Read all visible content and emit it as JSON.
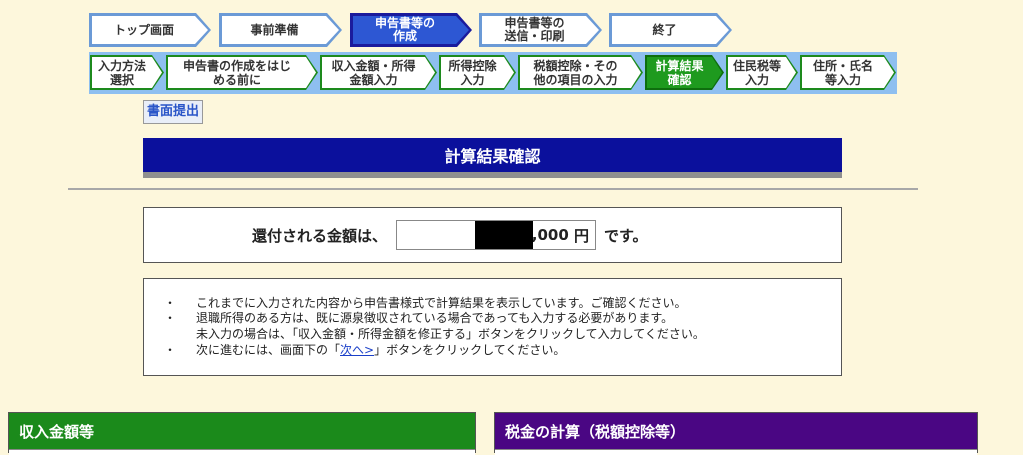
{
  "steps": [
    {
      "label": "トップ画面",
      "active": false
    },
    {
      "label": "事前準備",
      "active": false
    },
    {
      "label": "申告書等の\n作成",
      "active": true
    },
    {
      "label": "申告書等の\n送信・印刷",
      "active": false
    },
    {
      "label": "終了",
      "active": false
    }
  ],
  "substeps": [
    {
      "label": "入力方法\n選択",
      "active": false
    },
    {
      "label": "申告書の作成をはじ\nめる前に",
      "active": false
    },
    {
      "label": "収入金額・所得\n金額入力",
      "active": false
    },
    {
      "label": "所得控除\n入力",
      "active": false
    },
    {
      "label": "税額控除・その\n他の項目の入力",
      "active": false
    },
    {
      "label": "計算結果\n確認",
      "active": true
    },
    {
      "label": "住民税等\n入力",
      "active": false
    },
    {
      "label": "住所・氏名\n等入力",
      "active": false
    }
  ],
  "submit_label": "書面提出",
  "page_title": "計算結果確認",
  "refund": {
    "prefix": "還付される金額は、",
    "amount_suffix": ",000",
    "unit": "円",
    "suffix": "です。"
  },
  "notes": {
    "bullet": "・",
    "line1": "これまでに入力された内容から申告書様式で計算結果を表示しています。ご確認ください。",
    "line2": "退職所得のある方は、既に源泉徴収されている場合であっても入力する必要があります。",
    "line3": "未入力の場合は、「収入金額・所得金額を修正する」ボタンをクリックして入力してください。",
    "line4_pre": "次に進むには、画面下の「",
    "line4_link": "次へ>",
    "line4_post": "」ボタンをクリックしてください。"
  },
  "panels": {
    "income_title": "収入金額等",
    "tax_title": "税金の計算（税額控除等）"
  },
  "colors": {
    "background": "#fdf7dc",
    "title_bar": "#0b109c",
    "income_panel": "#1b8a1b",
    "tax_panel": "#4a0683",
    "active_step": "#2d57d3",
    "active_substep": "#1e9a1e"
  }
}
